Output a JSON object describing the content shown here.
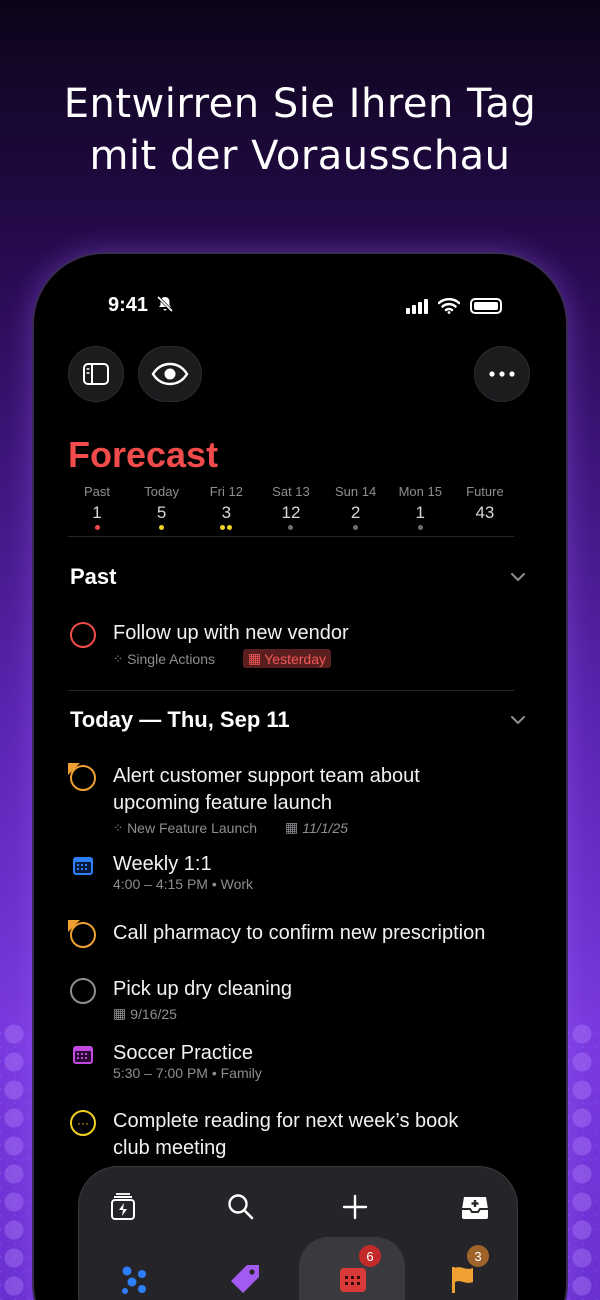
{
  "headline": {
    "line1": "Entwirren Sie Ihren Tag",
    "line2": "mit der Vorausschau"
  },
  "status_bar": {
    "time": "9:41"
  },
  "toolbar": {
    "sidebar_icon": "sidebar-icon",
    "eye_icon": "eye-icon",
    "more_icon": "more-icon"
  },
  "forecast": {
    "title": "Forecast",
    "days": [
      {
        "name": "Past",
        "count": "1",
        "dots": [
          "#f14b4b"
        ]
      },
      {
        "name": "Today",
        "count": "5",
        "dots": [
          "#f0d020"
        ]
      },
      {
        "name": "Fri 12",
        "count": "3",
        "dots": [
          "#f0d020",
          "#f0d020"
        ]
      },
      {
        "name": "Sat 13",
        "count": "12",
        "dots": [
          "#6e6e73"
        ]
      },
      {
        "name": "Sun 14",
        "count": "2",
        "dots": [
          "#6e6e73"
        ]
      },
      {
        "name": "Mon 15",
        "count": "1",
        "dots": [
          "#6e6e73"
        ]
      },
      {
        "name": "Future",
        "count": "43",
        "dots": []
      }
    ]
  },
  "sections": {
    "past": {
      "title": "Past",
      "task": {
        "title": "Follow up with new vendor",
        "project": "Single Actions",
        "due": "Yesterday"
      }
    },
    "today": {
      "title": "Today — Thu, Sep 11",
      "items": [
        {
          "title_line1": "Alert customer support team about",
          "title_line2": "upcoming feature launch",
          "project": "New Feature Launch",
          "date": "11/1/25"
        },
        {
          "title": "Weekly 1:1",
          "detail": "4:00 – 4:15 PM • Work"
        },
        {
          "title": "Call pharmacy to confirm new prescription"
        },
        {
          "title": "Pick up dry cleaning",
          "date": "9/16/25"
        },
        {
          "title": "Soccer Practice",
          "detail": "5:30 – 7:00 PM • Family"
        },
        {
          "title_line1": "Complete reading for next week’s book",
          "title_line2": "club meeting"
        }
      ]
    }
  },
  "tab_bar": {
    "top_row": [
      "bolt-stack-icon",
      "search-icon",
      "plus-icon",
      "inbox-add-icon"
    ],
    "bottom_row": [
      "projects-icon",
      "tags-icon",
      "forecast-icon",
      "flagged-icon"
    ],
    "forecast_badge": "6",
    "flagged_badge": "3"
  },
  "colors": {
    "accent_red": "#f14b4b",
    "flag_orange": "#f0a030",
    "due_yellow": "#f0d020",
    "work_blue": "#2d7ff9",
    "family_purple": "#c04ae0"
  }
}
